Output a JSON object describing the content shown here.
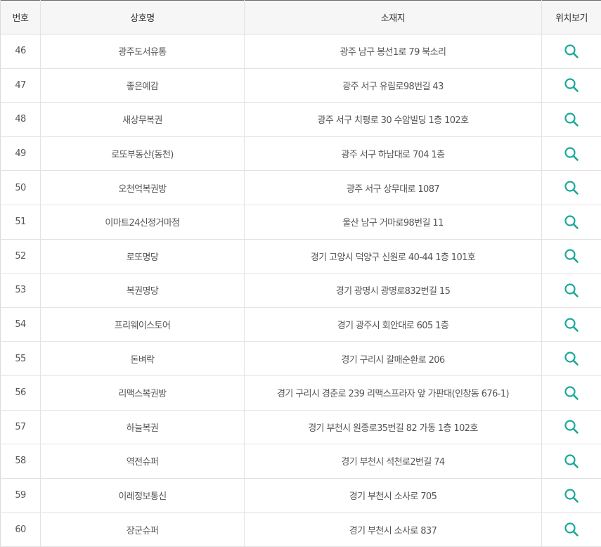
{
  "table": {
    "headers": {
      "number": "번호",
      "name": "상호명",
      "address": "소재지",
      "map": "위치보기"
    },
    "accent_color": "#1aa89a",
    "rows": [
      {
        "number": "46",
        "name": "광주도서유통",
        "address": "광주 남구 봉선1로 79 북소리",
        "icon": "search-icon"
      },
      {
        "number": "47",
        "name": "좋은예감",
        "address": "광주 서구 유림로98번길 43",
        "icon": "search-icon"
      },
      {
        "number": "48",
        "name": "새상무복권",
        "address": "광주 서구 치평로 30 수암빌딩 1층 102호",
        "icon": "search-icon"
      },
      {
        "number": "49",
        "name": "로또부동산(동천)",
        "address": "광주 서구 하남대로 704 1층",
        "icon": "search-icon"
      },
      {
        "number": "50",
        "name": "오천억복권방",
        "address": "광주 서구 상무대로 1087",
        "icon": "search-icon"
      },
      {
        "number": "51",
        "name": "이마트24신정거마점",
        "address": "울산 남구 거마로98번길 11",
        "icon": "search-icon"
      },
      {
        "number": "52",
        "name": "로또명당",
        "address": "경기 고양시 덕양구 신원로 40-44 1층 101호",
        "icon": "search-icon"
      },
      {
        "number": "53",
        "name": "복권명당",
        "address": "경기 광명시 광명로832번길 15",
        "icon": "search-icon"
      },
      {
        "number": "54",
        "name": "프리웨이스토어",
        "address": "경기 광주시 회안대로 605 1층",
        "icon": "search-icon"
      },
      {
        "number": "55",
        "name": "돈벼락",
        "address": "경기 구리시 갈매순환로 206",
        "icon": "search-icon"
      },
      {
        "number": "56",
        "name": "리맥스복권방",
        "address": "경기 구리시 경춘로 239 리맥스프라자 앞 가판대(인창동 676-1)",
        "icon": "search-icon"
      },
      {
        "number": "57",
        "name": "하늘복권",
        "address": "경기 부천시 원종로35번길 82 가동 1층 102호",
        "icon": "search-icon"
      },
      {
        "number": "58",
        "name": "역전슈퍼",
        "address": "경기 부천시 석천로2번길 74",
        "icon": "search-icon"
      },
      {
        "number": "59",
        "name": "이레정보통신",
        "address": "경기 부천시 소사로 705",
        "icon": "search-icon"
      },
      {
        "number": "60",
        "name": "장군슈퍼",
        "address": "경기 부천시 소사로 837",
        "icon": "search-icon"
      }
    ]
  }
}
